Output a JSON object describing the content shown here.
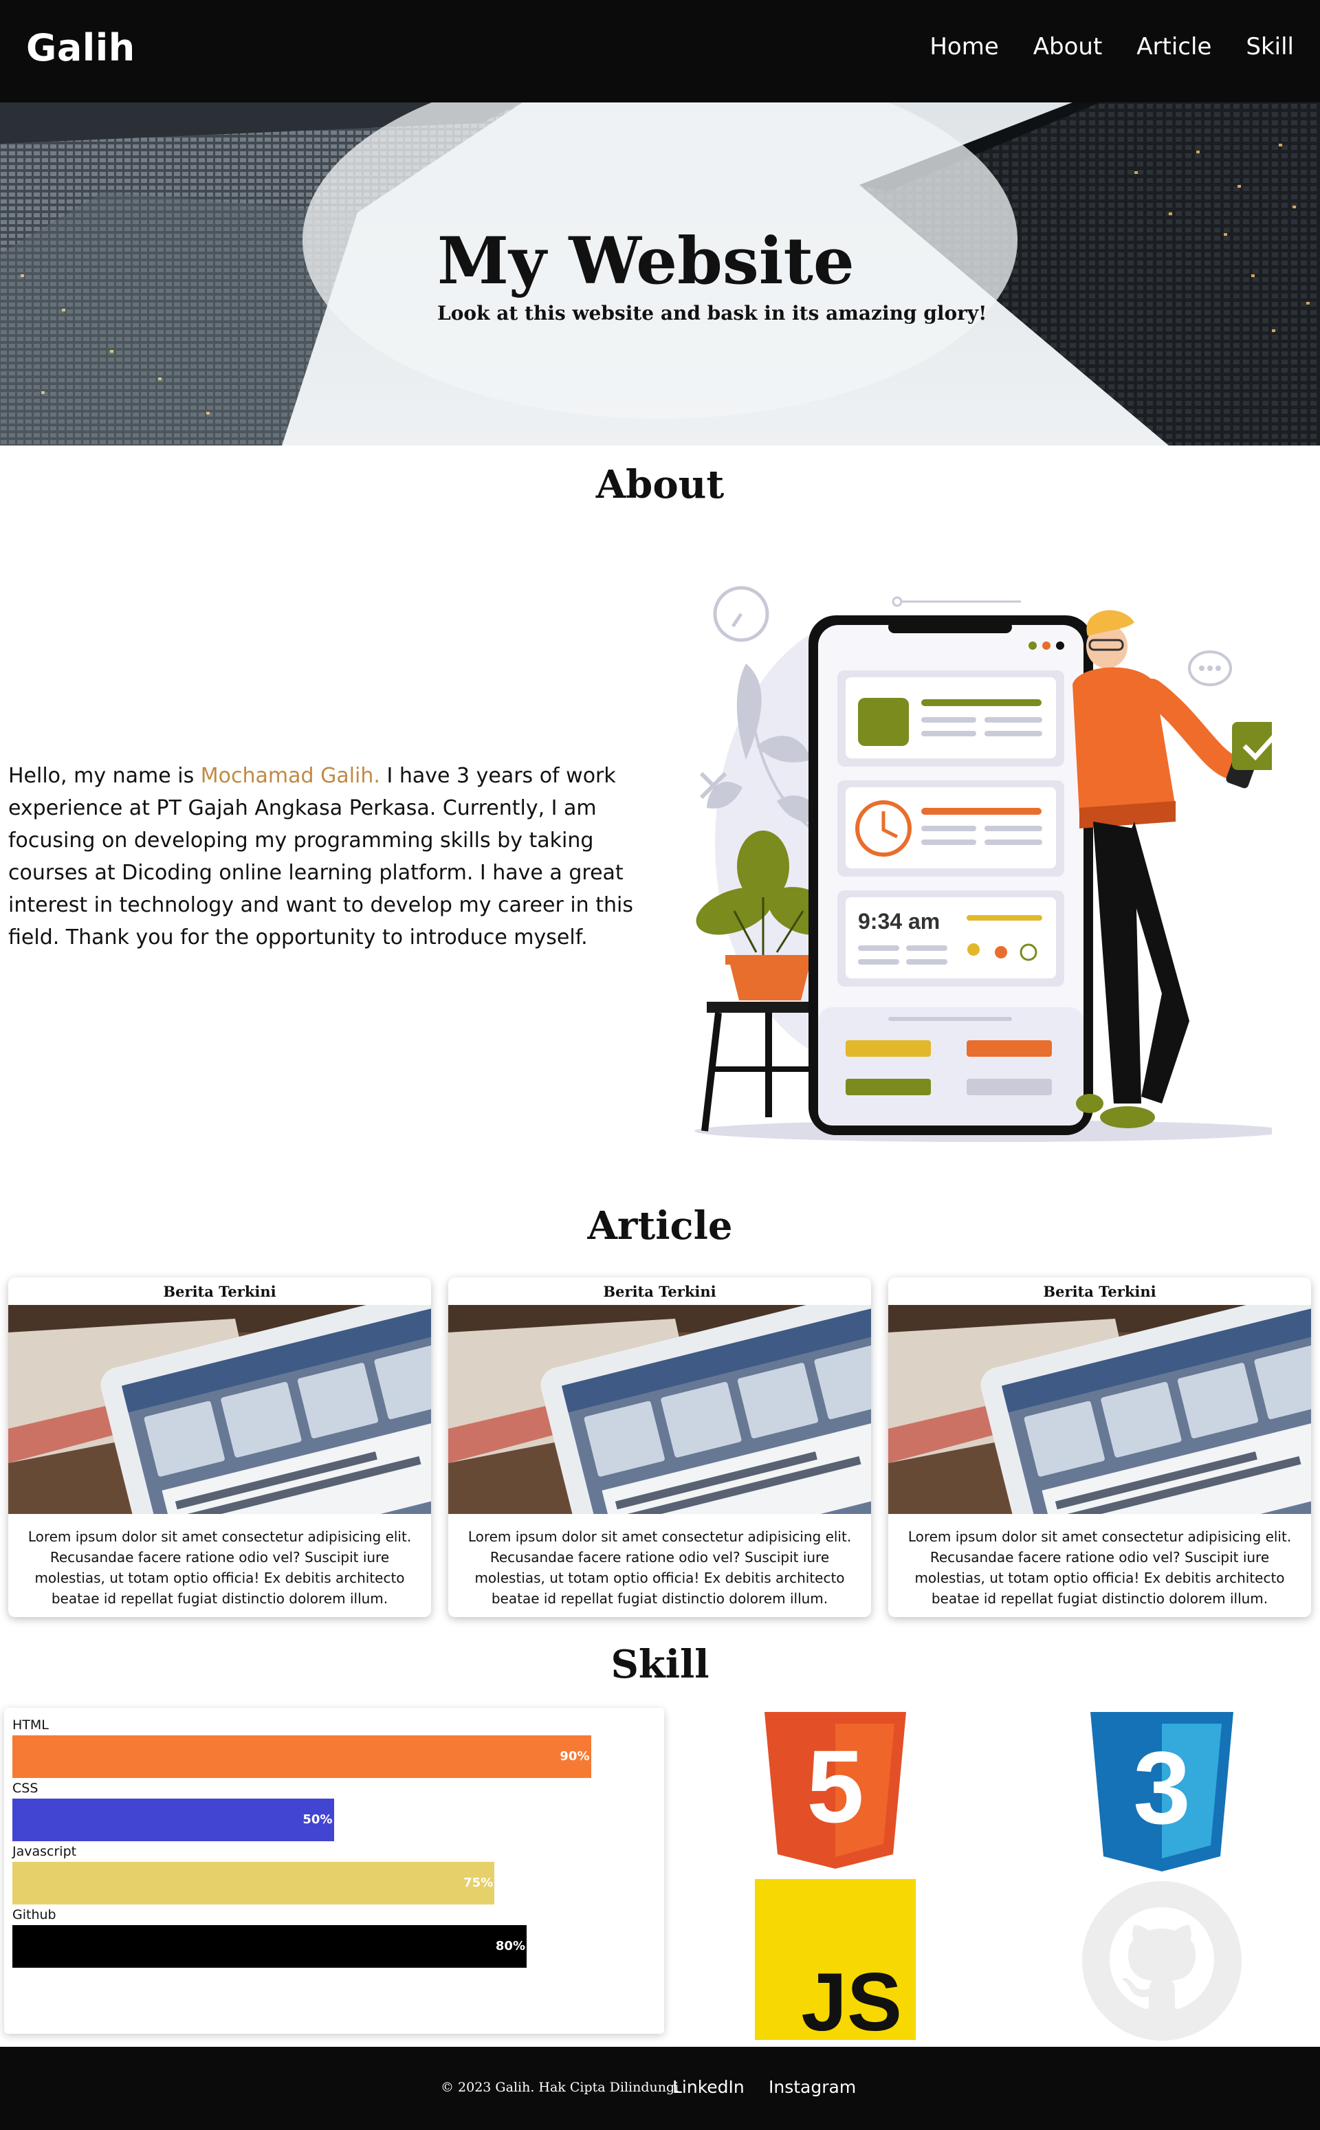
{
  "nav": {
    "brand": "Galih",
    "links": [
      "Home",
      "About",
      "Article",
      "Skill"
    ]
  },
  "hero": {
    "title": "My Website",
    "subtitle": "Look at this website and bask in its amazing glory!"
  },
  "about": {
    "heading": "About",
    "intro": "Hello, my name is ",
    "name": "Mochamad Galih.",
    "body": " I have 3 years of work experience at PT Gajah Angkasa Perkasa. Currently, I am focusing on developing my programming skills by taking courses at Dicoding online learning platform. I have a great interest in technology and want to develop my career in this field. Thank you for the opportunity to introduce myself.",
    "illustration": {
      "time": "9:34 am"
    }
  },
  "article": {
    "heading": "Article",
    "cards": [
      {
        "title": "Berita Terkini",
        "text": "Lorem ipsum dolor sit amet consectetur adipisicing elit. Recusandae facere ratione odio vel? Suscipit iure molestias, ut totam optio officia! Ex debitis architecto beatae id repellat fugiat distinctio dolorem illum."
      },
      {
        "title": "Berita Terkini",
        "text": "Lorem ipsum dolor sit amet consectetur adipisicing elit. Recusandae facere ratione odio vel? Suscipit iure molestias, ut totam optio officia! Ex debitis architecto beatae id repellat fugiat distinctio dolorem illum."
      },
      {
        "title": "Berita Terkini",
        "text": "Lorem ipsum dolor sit amet consectetur adipisicing elit. Recusandae facere ratione odio vel? Suscipit iure molestias, ut totam optio officia! Ex debitis architecto beatae id repellat fugiat distinctio dolorem illum."
      }
    ]
  },
  "skill": {
    "heading": "Skill",
    "items": [
      {
        "label": "HTML",
        "percent": "90%",
        "value": 90,
        "color": "#f77a34"
      },
      {
        "label": "CSS",
        "percent": "50%",
        "value": 50,
        "color": "#4245d1"
      },
      {
        "label": "Javascript",
        "percent": "75%",
        "value": 75,
        "color": "#e6d06a"
      },
      {
        "label": "Github",
        "percent": "80%",
        "value": 80,
        "color": "#000000"
      }
    ],
    "logos": {
      "html5_number": "5",
      "css3_number": "3",
      "js_text": "JS"
    }
  },
  "footer": {
    "copyright": "© 2023 Galih. Hak Cipta Dilindungi",
    "links": [
      "LinkedIn",
      "Instagram"
    ]
  }
}
